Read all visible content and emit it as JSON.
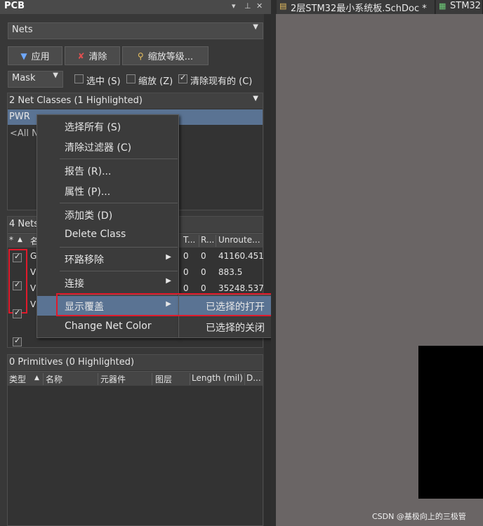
{
  "panel": {
    "title": "PCB",
    "title_icons": [
      "▾",
      "⊥",
      "✕"
    ],
    "mode_select": "Nets",
    "buttons": [
      {
        "label": "应用",
        "icon": "filter-icon"
      },
      {
        "label": "清除",
        "icon": "clear-filter-icon"
      },
      {
        "label": "缩放等级...",
        "icon": "magnify-icon"
      }
    ],
    "mask_select": "Mask",
    "options": [
      {
        "label": "选中 (S)",
        "checked": false
      },
      {
        "label": "缩放 (Z)",
        "checked": false
      },
      {
        "label": "清除现有的 (C)",
        "checked": true
      }
    ]
  },
  "net_classes": {
    "header": "2 Net Classes (1 Highlighted)",
    "items": [
      "PWR",
      "<All N"
    ]
  },
  "nets": {
    "header": "4 Nets",
    "columns": [
      "*",
      "名",
      "T...",
      "R...",
      "Unroute..."
    ],
    "rows": [
      {
        "name": "G",
        "t": "0",
        "r": "0",
        "unrouted": "41160.451",
        "checked": true
      },
      {
        "name": "V",
        "t": "0",
        "r": "0",
        "unrouted": "883.5",
        "checked": true
      },
      {
        "name": "V",
        "t": "0",
        "r": "0",
        "unrouted": "35248.537",
        "checked": true
      },
      {
        "name": "V",
        "t": "",
        "r": "",
        "unrouted": "",
        "checked": true
      }
    ]
  },
  "primitives": {
    "header": "0 Primitives (0 Highlighted)",
    "columns": [
      "类型",
      "名称",
      "元器件",
      "图层",
      "Length (mil)",
      "D..."
    ]
  },
  "context_menu": {
    "items": [
      {
        "label": "选择所有 (S)"
      },
      {
        "label": "清除过滤器 (C)"
      },
      {
        "label": "报告 (R)..."
      },
      {
        "label": "属性 (P)..."
      },
      {
        "label": "添加类 (D)"
      },
      {
        "label": "Delete Class"
      },
      {
        "label": "环路移除"
      },
      {
        "label": "连接"
      },
      {
        "label": "显示覆盖"
      },
      {
        "label": "Change Net Color"
      }
    ],
    "submenu": [
      "已选择的打开",
      "已选择的关闭"
    ]
  },
  "tabs": [
    {
      "label": "2层STM32最小系统板.SchDoc *"
    },
    {
      "label": "STM32"
    }
  ],
  "watermark": "CSDN @基极向上的三极管",
  "colors": {
    "highlight": "#5a7393",
    "annotation_red": "#e01a2b",
    "canvas": "#6a6565"
  }
}
